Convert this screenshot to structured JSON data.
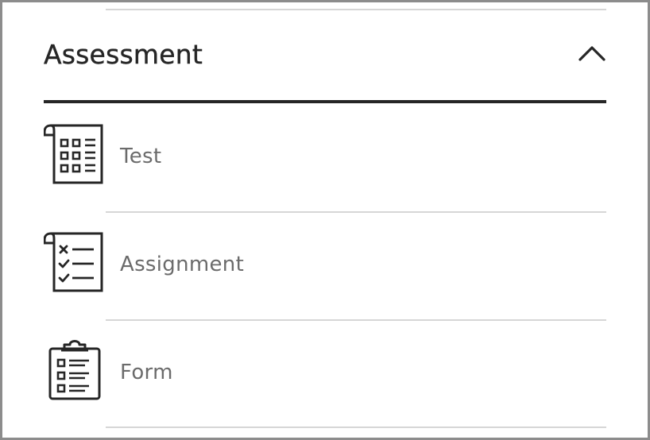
{
  "section": {
    "title": "Assessment",
    "toggle_icon": "chevron-up-icon",
    "expanded": true
  },
  "items": [
    {
      "label": "Test",
      "icon": "test-calculator-icon"
    },
    {
      "label": "Assignment",
      "icon": "assignment-checklist-icon"
    },
    {
      "label": "Form",
      "icon": "form-clipboard-icon"
    }
  ],
  "colors": {
    "text_dark": "#262626",
    "text_label": "#6b6b6b",
    "divider": "#d6d6d6",
    "border": "#8c8c8c"
  }
}
